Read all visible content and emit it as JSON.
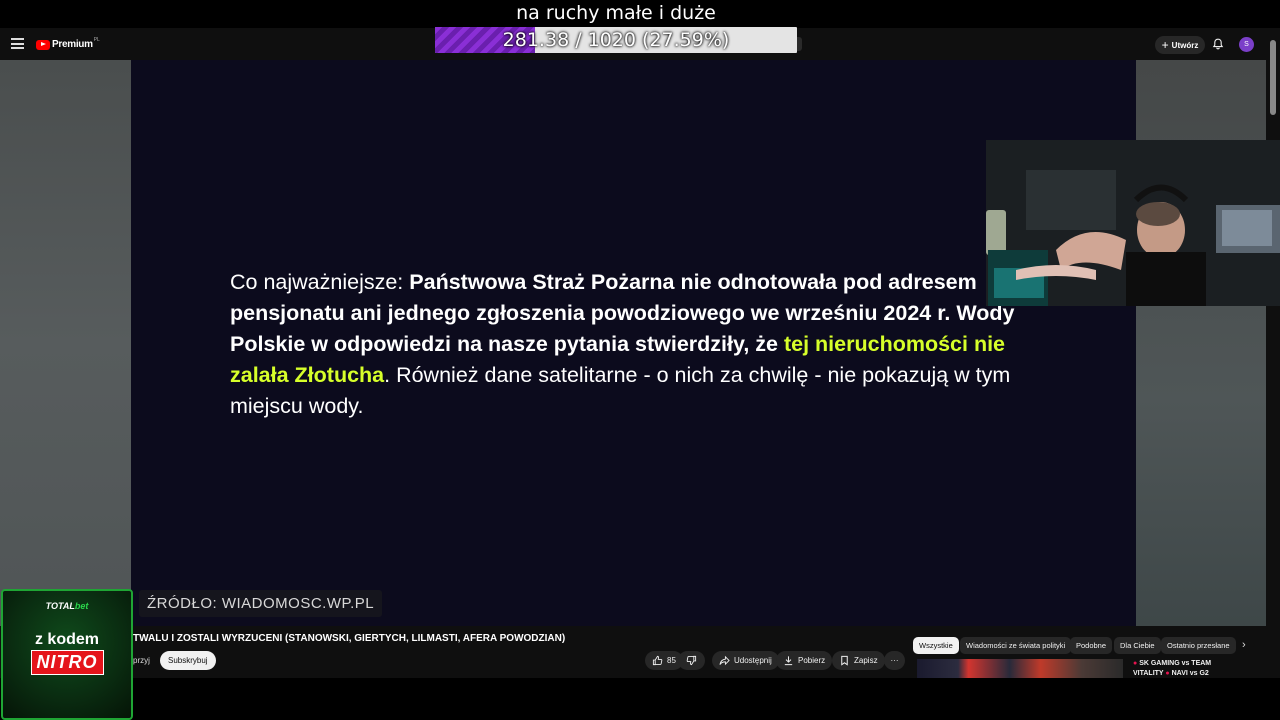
{
  "overlay": {
    "title": "na ruchy małe i duże"
  },
  "progress": {
    "text": "281.38 / 1020 (27.59%)",
    "fraction": 0.2759
  },
  "topbar": {
    "logo_text": "Premium",
    "logo_region": "PL",
    "create_label": "Utwórz",
    "avatar_letter": "S"
  },
  "video": {
    "article": {
      "lead": "Co najważniejsze: ",
      "bold1": "Państwowa Straż Pożarna nie odnotowała pod adresem pensjonatu ani jednego zgłoszenia powodziowego we wrześniu 2024 r. Wody Polskie w odpowiedzi na nasze pytania stwierdziły, że ",
      "highlight": "tej nieruchomości nie zalała Złotucha",
      "rest": ". Również dane satelitarne - o nich za chwilę - nie pokazują w tym miejscu wody."
    },
    "source": "ŹRÓDŁO: WIADOMOSC.WP.PL"
  },
  "sponsor": {
    "brand_a": "TOTAL",
    "brand_b": "bet",
    "code_label": "z kodem",
    "code": "NITRO"
  },
  "info": {
    "title": "TWALU I ZOSTALI WYRZUCENI (STANOWSKI, GIERTYCH, LILMASTI, AFERA POWODZIAN)",
    "channel_fragment": "przyj",
    "subscribe_label": "Subskrybuj",
    "like_count": "85",
    "share_label": "Udostępnij",
    "download_label": "Pobierz",
    "save_label": "Zapisz",
    "more_label": "···"
  },
  "chips": [
    "Wszystkie",
    "Wiadomości ze świata polityki",
    "Podobne",
    "Dla Ciebie",
    "Ostatnio przesłane"
  ],
  "recommended": {
    "line1": "SK GAMING vs TEAM",
    "line2_a": "VITALITY",
    "line2_b": "NAVI vs G2"
  },
  "colors": {
    "highlight": "#d7ff2a",
    "progress": "#8a2fd6",
    "avatar": "#7b3fc9",
    "sponsor_green": "#1fa534"
  }
}
